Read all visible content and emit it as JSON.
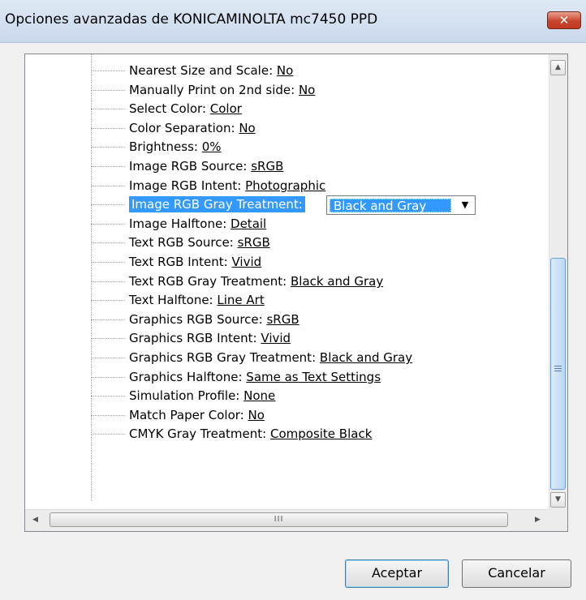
{
  "window": {
    "title": "Opciones avanzadas de KONICAMINOLTA mc7450 PPD",
    "close_symbol": "✕"
  },
  "tree": {
    "items": [
      {
        "label": "Nearest Size and Scale:",
        "value": "No"
      },
      {
        "label": "Manually Print on 2nd side:",
        "value": "No"
      },
      {
        "label": "Select Color:",
        "value": "Color"
      },
      {
        "label": "Color Separation:",
        "value": "No"
      },
      {
        "label": "Brightness:",
        "value": "0%"
      },
      {
        "label": "Image RGB Source:",
        "value": "sRGB"
      },
      {
        "label": "Image RGB Intent:",
        "value": "Photographic"
      },
      {
        "label": "Image RGB Gray Treatment:",
        "value": "Black and Gray",
        "selected": true,
        "editing": true
      },
      {
        "label": "Image Halftone:",
        "value": "Detail"
      },
      {
        "label": "Text RGB Source:",
        "value": "sRGB"
      },
      {
        "label": "Text RGB Intent:",
        "value": "Vivid"
      },
      {
        "label": "Text RGB Gray Treatment:",
        "value": "Black and Gray"
      },
      {
        "label": "Text Halftone:",
        "value": "Line Art"
      },
      {
        "label": "Graphics RGB Source:",
        "value": "sRGB"
      },
      {
        "label": "Graphics RGB Intent:",
        "value": "Vivid"
      },
      {
        "label": "Graphics RGB Gray Treatment:",
        "value": "Black and Gray"
      },
      {
        "label": "Graphics Halftone:",
        "value": "Same as Text Settings"
      },
      {
        "label": "Simulation Profile:",
        "value": "None"
      },
      {
        "label": "Match Paper Color:",
        "value": "No"
      },
      {
        "label": "CMYK Gray Treatment:",
        "value": "Composite Black"
      }
    ]
  },
  "scrollbars": {
    "up_arrow": "▲",
    "down_arrow": "▼",
    "left_arrow": "◀",
    "right_arrow": "▶",
    "thumb_grip": "III"
  },
  "buttons": {
    "ok_label": "Aceptar",
    "cancel_label": "Cancelar"
  },
  "colors": {
    "selection": "#3399ff",
    "scroll_thumb": "#bcd7f2",
    "close_button": "#c8452d"
  }
}
